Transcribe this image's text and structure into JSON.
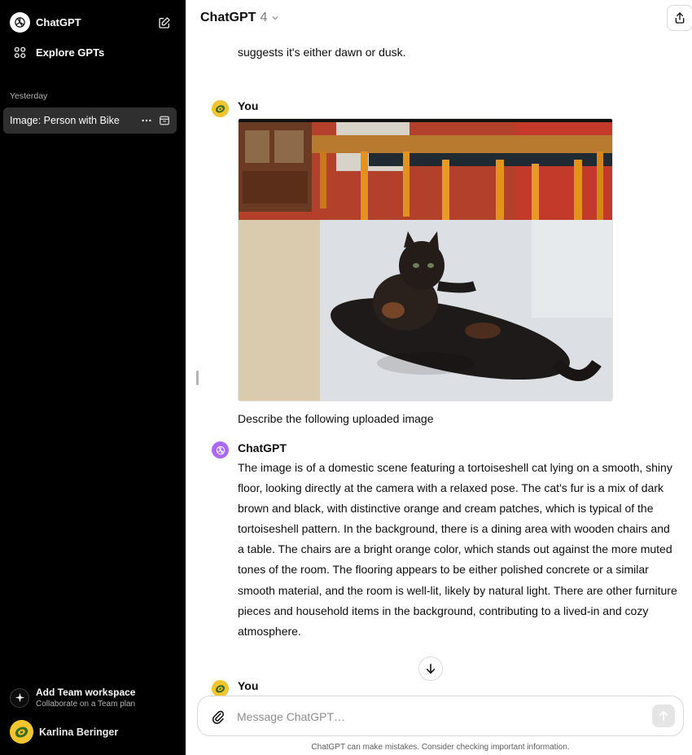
{
  "sidebar": {
    "app_title": "ChatGPT",
    "explore_label": "Explore GPTs",
    "section_label": "Yesterday",
    "chats": [
      {
        "label": "Image: Person with Bike"
      }
    ],
    "team": {
      "title": "Add Team workspace",
      "subtitle": "Collaborate on a Team plan"
    },
    "user": {
      "name": "Karlina Beringer"
    }
  },
  "header": {
    "model_name": "ChatGPT",
    "model_version": "4"
  },
  "conversation": {
    "previous_tail": "suggests it's either dawn or dusk.",
    "messages": [
      {
        "author": "You",
        "image_description": "tortoiseshell cat lying on floor",
        "text": "Describe the following uploaded image"
      },
      {
        "author": "ChatGPT",
        "text": "The image is of a domestic scene featuring a tortoiseshell cat lying on a smooth, shiny floor, looking directly at the camera with a relaxed pose. The cat's fur is a mix of dark brown and black, with distinctive orange and cream patches, which is typical of the tortoiseshell pattern. In the background, there is a dining area with wooden chairs and a table. The chairs are a bright orange color, which stands out against the more muted tones of the room. The flooring appears to be either polished concrete or a similar smooth material, and the room is well-lit, likely by natural light. There are other furniture pieces and household items in the background, contributing to a lived-in and cozy atmosphere."
      },
      {
        "author": "You"
      }
    ]
  },
  "composer": {
    "placeholder": "Message ChatGPT…"
  },
  "disclaimer": "ChatGPT can make mistakes. Consider checking important information.",
  "colors": {
    "sidebar_bg": "#000000",
    "active_chat_bg": "#2f2f2f",
    "bot_avatar": "#ab68ff",
    "user_avatar": "#f3c431"
  }
}
